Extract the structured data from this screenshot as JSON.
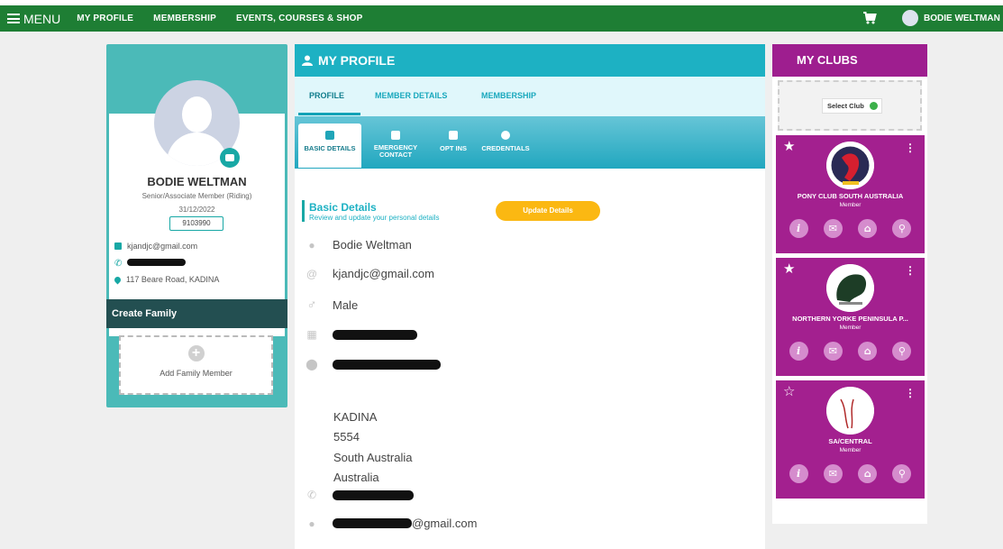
{
  "nav": {
    "menu_label": "MENU",
    "links": [
      "MY PROFILE",
      "MEMBERSHIP",
      "EVENTS, COURSES & SHOP"
    ],
    "user_name": "BODIE WELTMAN"
  },
  "profile_card": {
    "name": "BODIE WELTMAN",
    "membership_type": "Senior/Associate Member (Riding)",
    "expiry": "31/12/2022",
    "member_number": "9103990",
    "email": "kjandjc@gmail.com",
    "address": "117 Beare Road, KADINA",
    "create_family_label": "Create Family",
    "add_family_label": "Add Family Member"
  },
  "main": {
    "title": "MY PROFILE",
    "tabs": [
      {
        "label": "PROFILE",
        "active": true
      },
      {
        "label": "MEMBER DETAILS",
        "active": false
      },
      {
        "label": "MEMBERSHIP",
        "active": false
      }
    ],
    "subtabs": [
      {
        "label": "BASIC DETAILS",
        "icon": "person-icon",
        "active": true
      },
      {
        "label": "EMERGENCY\nCONTACT",
        "icon": "contact-card-icon",
        "active": false
      },
      {
        "label": "OPT INS",
        "icon": "list-icon",
        "active": false
      },
      {
        "label": "CREDENTIALS",
        "icon": "badge-icon",
        "active": false
      }
    ],
    "section_title": "Basic Details",
    "section_subtitle": "Review and update your personal details",
    "update_button": "Update Details",
    "details": {
      "name": "Bodie Weltman",
      "email": "kjandjc@gmail.com",
      "gender": "Male",
      "city": "KADINA",
      "postcode": "5554",
      "state": "South Australia",
      "country": "Australia",
      "secondary_email_suffix": "@gmail.com"
    }
  },
  "clubs": {
    "title": "MY CLUBS",
    "select_label": "Select Club",
    "items": [
      {
        "name": "PONY CLUB SOUTH AUSTRALIA",
        "role": "Member",
        "favourite": true
      },
      {
        "name": "NORTHERN YORKE PENINSULA P...",
        "role": "Member",
        "favourite": true
      },
      {
        "name": "SA/CENTRAL",
        "role": "Member",
        "favourite": false
      }
    ]
  },
  "colors": {
    "nav_green": "#1e7e34",
    "teal": "#1db1c3",
    "club_purple": "#a3208f",
    "update_orange": "#fbb812"
  }
}
